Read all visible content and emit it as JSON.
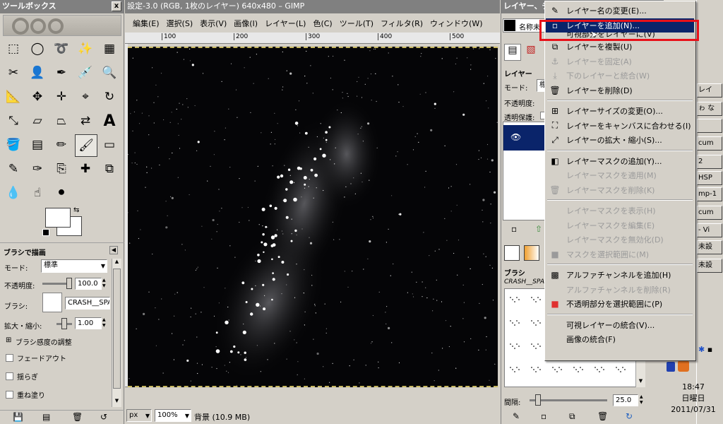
{
  "toolbox": {
    "title": "ツールボックス",
    "close": "x",
    "tools": [
      {
        "icon": "rect-select-icon",
        "glyph": "⬚"
      },
      {
        "icon": "ellipse-select-icon",
        "glyph": "◯"
      },
      {
        "icon": "lasso-icon",
        "glyph": "➰"
      },
      {
        "icon": "fuzzy-select-icon",
        "glyph": "✨"
      },
      {
        "icon": "color-select-icon",
        "glyph": "▦"
      },
      {
        "icon": "scissors-icon",
        "glyph": "✂"
      },
      {
        "icon": "foreground-select-icon",
        "glyph": "👤"
      },
      {
        "icon": "paths-icon",
        "glyph": "✒"
      },
      {
        "icon": "color-picker-icon",
        "glyph": "💉"
      },
      {
        "icon": "zoom-icon",
        "glyph": "🔍"
      },
      {
        "icon": "measure-icon",
        "glyph": "📐"
      },
      {
        "icon": "move-icon",
        "glyph": "✥"
      },
      {
        "icon": "align-icon",
        "glyph": "✛"
      },
      {
        "icon": "crop-icon",
        "glyph": "⌖"
      },
      {
        "icon": "rotate-icon",
        "glyph": "↻"
      },
      {
        "icon": "scale-icon",
        "glyph": "⤡"
      },
      {
        "icon": "shear-icon",
        "glyph": "▱"
      },
      {
        "icon": "perspective-icon",
        "glyph": "⏢"
      },
      {
        "icon": "flip-icon",
        "glyph": "⇄"
      },
      {
        "icon": "text-icon",
        "glyph": "A"
      },
      {
        "icon": "bucket-fill-icon",
        "glyph": "🪣"
      },
      {
        "icon": "blend-icon",
        "glyph": "▤"
      },
      {
        "icon": "pencil-icon",
        "glyph": "✏"
      },
      {
        "icon": "paintbrush-icon",
        "glyph": "🖌"
      },
      {
        "icon": "eraser-icon",
        "glyph": "▭"
      },
      {
        "icon": "airbrush-icon",
        "glyph": "✎"
      },
      {
        "icon": "ink-icon",
        "glyph": "✑"
      },
      {
        "icon": "clone-icon",
        "glyph": "⎘"
      },
      {
        "icon": "heal-icon",
        "glyph": "✚"
      },
      {
        "icon": "perspective-clone-icon",
        "glyph": "⧉"
      },
      {
        "icon": "blur-icon",
        "glyph": "💧"
      },
      {
        "icon": "smudge-icon",
        "glyph": "☝"
      },
      {
        "icon": "dodge-burn-icon",
        "glyph": "⚫"
      }
    ],
    "brush_options": {
      "title": "ブラシで描画",
      "mode_label": "モード:",
      "mode_value": "標準",
      "opacity_label": "不透明度:",
      "opacity_value": "100.0",
      "brush_label": "ブラシ:",
      "brush_name": "CRASH__SPA",
      "scale_label": "拡大・縮小:",
      "scale_value": "1.00",
      "pressure_label": "ブラシ感度の調整",
      "fade_label": "フェードアウト",
      "jitter_label": "揺らぎ",
      "incremental_label": "重ね塗り"
    }
  },
  "image_window": {
    "title": "設定-3.0 (RGB, 1枚のレイヤー) 640x480 – GIMP",
    "menus": [
      "編集(E)",
      "選択(S)",
      "表示(V)",
      "画像(I)",
      "レイヤー(L)",
      "色(C)",
      "ツール(T)",
      "フィルタ(R)",
      "ウィンドウ(W)"
    ],
    "ruler_ticks": [
      "100",
      "200",
      "300",
      "400",
      "500"
    ],
    "status": {
      "unit": "px",
      "zoom": "100%",
      "info": "背景 (10.9 MB)"
    }
  },
  "layers_dock": {
    "title": "レイヤー、チ",
    "image_label": "名称未",
    "tab_title": "レイヤー",
    "mode_label": "モード:",
    "mode_value": "標",
    "opacity_label": "不透明度:",
    "lock_label": "透明保護:",
    "brushes_title": "ブラシ",
    "brush_name": "CRASH__SPA",
    "spacing_label": "間隔:",
    "spacing_value": "25.0"
  },
  "context_menu": {
    "items": [
      {
        "label": "レイヤー名の変更(E)...",
        "icon": "edit-icon",
        "glyph": "✎",
        "state": "normal"
      },
      {
        "label": "レイヤーを追加(N)...",
        "icon": "new-layer-icon",
        "glyph": "▫",
        "state": "selected"
      },
      {
        "label": "可視部分をレイヤーに(V)",
        "icon": "none",
        "glyph": "",
        "state": "partial"
      },
      {
        "label": "レイヤーを複製(U)",
        "icon": "duplicate-icon",
        "glyph": "⧉",
        "state": "normal"
      },
      {
        "label": "レイヤーを固定(A)",
        "icon": "anchor-icon",
        "glyph": "⚓",
        "state": "disabled"
      },
      {
        "label": "下のレイヤーと統合(W)",
        "icon": "merge-down-icon",
        "glyph": "⤓",
        "state": "disabled"
      },
      {
        "label": "レイヤーを削除(D)",
        "icon": "delete-icon",
        "glyph": "🗑",
        "state": "normal"
      },
      {
        "sep": true
      },
      {
        "label": "レイヤーサイズの変更(O)...",
        "icon": "resize-icon",
        "glyph": "⊞",
        "state": "normal"
      },
      {
        "label": "レイヤーをキャンバスに合わせる(I)",
        "icon": "fit-canvas-icon",
        "glyph": "⛶",
        "state": "normal"
      },
      {
        "label": "レイヤーの拡大・縮小(S)...",
        "icon": "scale-layer-icon",
        "glyph": "⤢",
        "state": "normal"
      },
      {
        "sep": true
      },
      {
        "label": "レイヤーマスクの追加(Y)...",
        "icon": "add-mask-icon",
        "glyph": "◧",
        "state": "normal"
      },
      {
        "label": "レイヤーマスクを適用(M)",
        "icon": "none",
        "glyph": "",
        "state": "disabled"
      },
      {
        "label": "レイヤーマスクを削除(K)",
        "icon": "delete-mask-icon",
        "glyph": "🗑",
        "state": "disabled"
      },
      {
        "sep": true
      },
      {
        "label": "レイヤーマスクを表示(H)",
        "icon": "none",
        "glyph": "",
        "state": "disabled"
      },
      {
        "label": "レイヤーマスクを編集(E)",
        "icon": "none",
        "glyph": "",
        "state": "disabled"
      },
      {
        "label": "レイヤーマスクを無効化(D)",
        "icon": "none",
        "glyph": "",
        "state": "disabled"
      },
      {
        "label": "マスクを選択範囲に(M)",
        "icon": "mask-to-selection-icon",
        "glyph": "■",
        "state": "disabled"
      },
      {
        "sep": true
      },
      {
        "label": "アルファチャンネルを追加(H)",
        "icon": "alpha-icon",
        "glyph": "▩",
        "state": "normal"
      },
      {
        "label": "アルファチャンネルを削除(R)",
        "icon": "none",
        "glyph": "",
        "state": "disabled"
      },
      {
        "label": "不透明部分を選択範囲に(P)",
        "icon": "alpha-to-selection-icon",
        "glyph": "■",
        "state": "normal"
      },
      {
        "sep": true
      },
      {
        "label": "可視レイヤーの統合(V)...",
        "icon": "none",
        "glyph": "",
        "state": "normal"
      },
      {
        "label": "画像の統合(F)",
        "icon": "none",
        "glyph": "",
        "state": "normal"
      }
    ]
  },
  "taskbar": {
    "items": [
      "レイ",
      "ゎ な",
      "",
      "cum",
      "2",
      "HSP",
      "mp-1",
      "cum",
      "- Vi",
      "未設",
      "未設"
    ],
    "time": "18:47",
    "weekday": "日曜日",
    "date": "2011/07/31"
  },
  "colors": {
    "selection": "#0a246a",
    "highlight_box": "#e8111a",
    "panel": "#d4d0c8"
  }
}
